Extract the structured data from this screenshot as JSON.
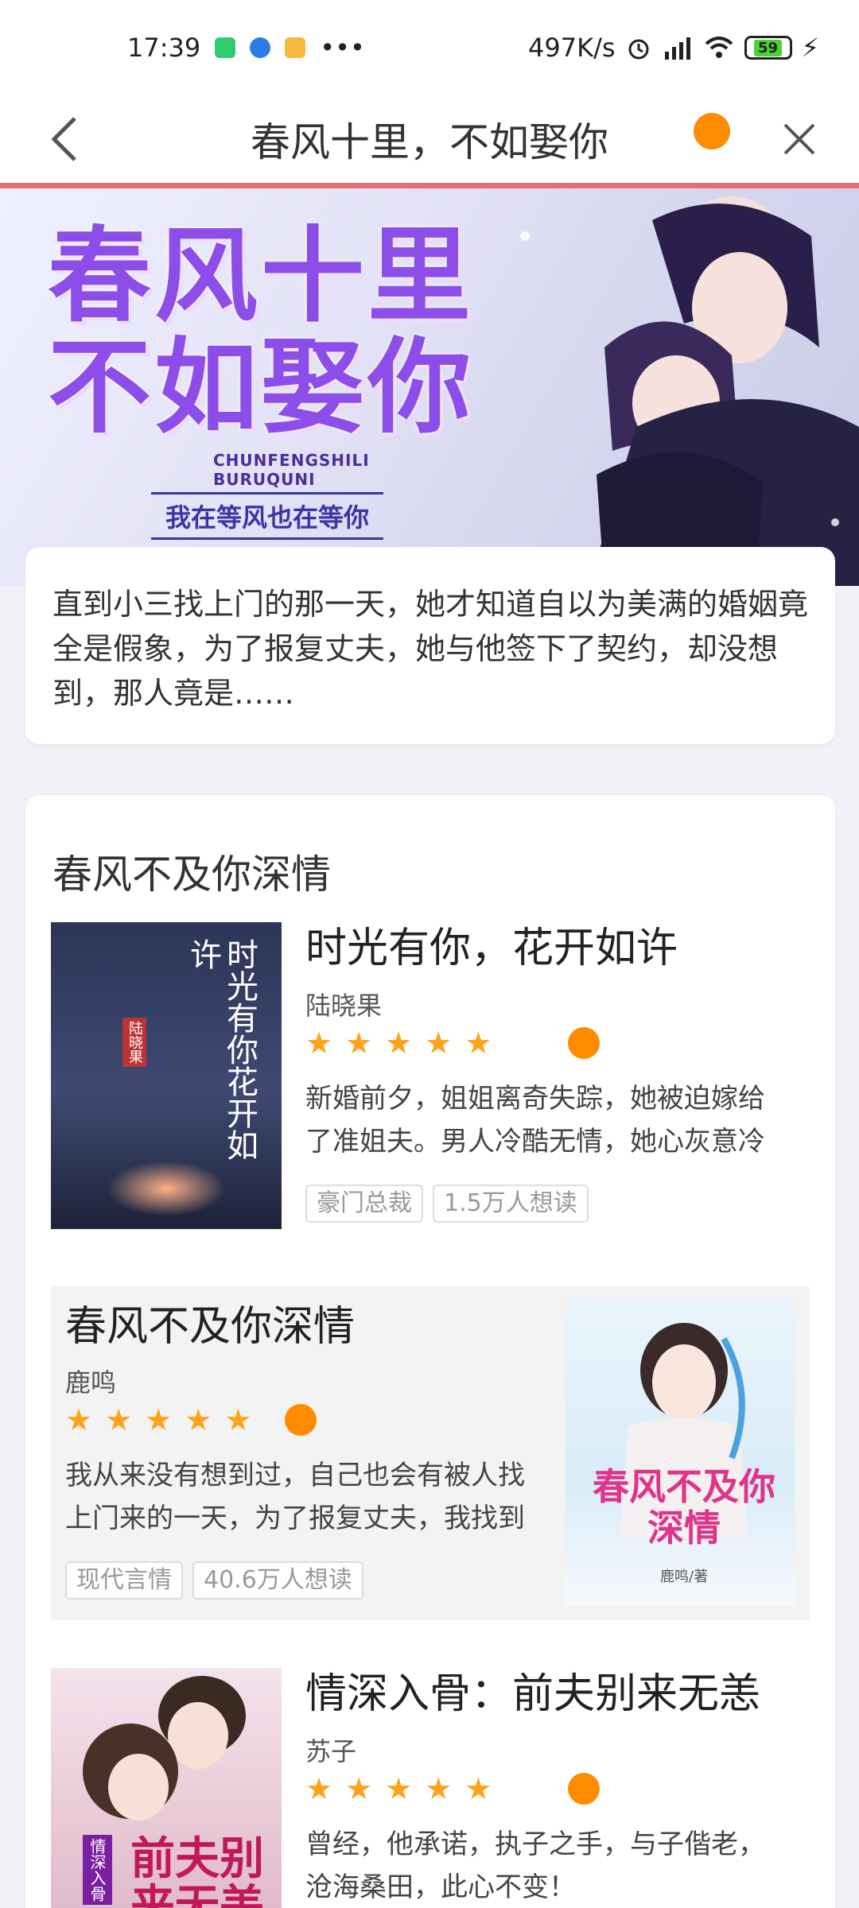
{
  "status": {
    "time": "17:39",
    "speed": "497K/s",
    "battery": "59"
  },
  "nav": {
    "title": "春风十里，不如娶你"
  },
  "banner": {
    "title_line1": "春风十里",
    "title_line2": "不如娶你",
    "pinyin_line1": "CHUNFENGSHILI",
    "pinyin_line2": "BURUQUNI",
    "tagline": "我在等风也在等你"
  },
  "intro": "直到小三找上门的那一天，她才知道自以为美满的婚姻竟全是假象，为了报复丈夫，她与他签下了契约，却没想到，那人竟是……",
  "section": {
    "title": "春风不及你深情"
  },
  "books": [
    {
      "title": "时光有你，花开如许",
      "author": "陆晓果",
      "rating": 5,
      "desc": "新婚前夕，姐姐离奇失踪，她被迫嫁给了准姐夫。男人冷酷无情，她心灰意冷",
      "tag": "豪门总裁",
      "readers": "1.5万人想读",
      "cover_text": "时光有你花开如许",
      "cover_author": "陆晓果"
    },
    {
      "title": "春风不及你深情",
      "author": "鹿鸣",
      "rating": 5,
      "desc": "我从来没有想到过，自己也会有被人找上门来的一天，为了报复丈夫，我找到",
      "tag": "现代言情",
      "readers": "40.6万人想读",
      "cover_text": "春风不及你深情",
      "cover_author": "鹿鸣/著"
    },
    {
      "title": "情深入骨：前夫别来无恙",
      "author": "苏子",
      "rating": 5,
      "desc": "曾经，他承诺，执子之手，与子偕老，沧海桑田，此心不变！",
      "cover_text": "前夫别来无恙",
      "cover_sub": "情深入骨"
    }
  ]
}
